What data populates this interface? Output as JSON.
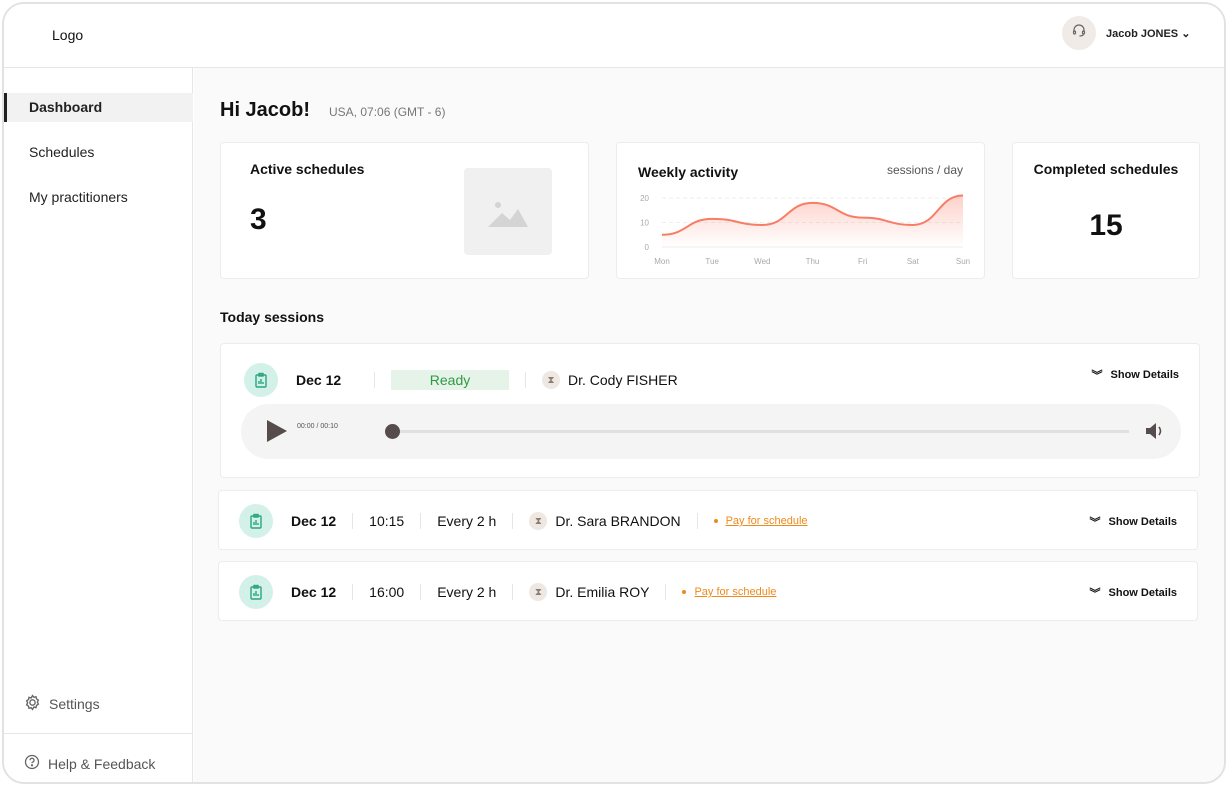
{
  "header": {
    "logo": "Logo",
    "user_name": "Jacob JONES"
  },
  "sidebar": {
    "items": [
      {
        "label": "Dashboard"
      },
      {
        "label": "Schedules"
      },
      {
        "label": "My practitioners"
      }
    ],
    "settings": "Settings",
    "help": "Help & Feedback"
  },
  "main": {
    "greeting": "Hi Jacob!",
    "timezone": "USA, 07:06 (GMT - 6)",
    "active": {
      "title": "Active schedules",
      "value": "3"
    },
    "weekly": {
      "title": "Weekly activity",
      "unit": "sessions / day"
    },
    "completed": {
      "title": "Completed schedules",
      "value": "15"
    },
    "section": "Today sessions",
    "sessions": [
      {
        "date": "Dec 12",
        "status": "Ready",
        "doctor": "Dr. Cody FISHER",
        "details": "Show Details",
        "time_current": "00:00",
        "time_total": "00:10"
      },
      {
        "date": "Dec 12",
        "time": "10:15",
        "freq": "Every 2 h",
        "doctor": "Dr. Sara BRANDON",
        "pay": "Pay for schedule",
        "details": "Show Details"
      },
      {
        "date": "Dec 12",
        "time": "16:00",
        "freq": "Every 2 h",
        "doctor": "Dr. Emilia ROY",
        "pay": "Pay for schedule",
        "details": "Show Details"
      }
    ]
  },
  "chart_data": {
    "type": "area",
    "title": "Weekly activity",
    "ylabel": "sessions / day",
    "categories": [
      "Mon",
      "Tue",
      "Wed",
      "Thu",
      "Fri",
      "Sat",
      "Sun"
    ],
    "values": [
      5,
      11.5,
      9,
      18,
      12,
      9,
      21
    ],
    "yticks": [
      "0",
      "10",
      "20"
    ],
    "ylim": [
      0,
      20
    ],
    "color": "#f97c66"
  }
}
